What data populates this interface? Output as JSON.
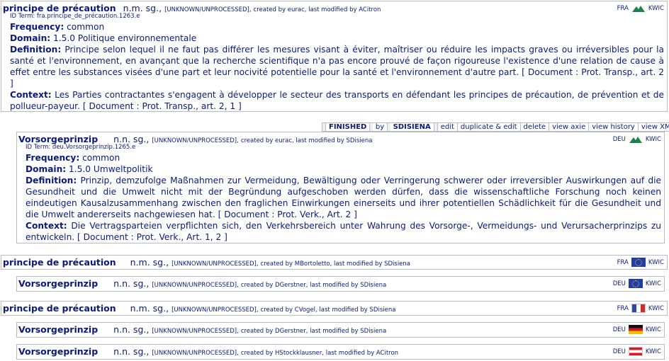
{
  "toolbar": {
    "status": "FINISHED",
    "by": "by",
    "user": "SDISIENA",
    "edit": "edit",
    "duplicate": "duplicate & edit",
    "delete": "delete",
    "view_axie": "view axie",
    "view_history": "view history",
    "view_xml": "view XML"
  },
  "entries": [
    {
      "term": "principe de précaution",
      "gram": "n.m. sg.,",
      "status": "[UNKNOWN/UNPROCESSED],",
      "meta": "created by eurac, last modified by ACitron",
      "lang": "FRA",
      "kwic": "KWIC",
      "flag": "alpine",
      "id_term": "ID Term: fra.principe_de_précaution.1263.e",
      "frequency_label": "Frequency:",
      "frequency": "common",
      "domain_label": "Domain:",
      "domain": "1.5.0 Politique environnementale",
      "definition_label": "Definition:",
      "definition": "Principe selon lequel il ne faut pas différer les mesures visant à éviter, maîtriser ou réduire les impacts graves ou irréversibles pour la santé et l'environnement, en avançant que la recherche scientifique n'a pas encore prouvé de façon rigoureuse l'existence d'une relation de cause à effet entre les substances visées d'une part et leur nocivité potentielle pour la santé et l'environnement d'autre part. [ Document : Prot. Transp., art. 2 ]",
      "context_label": "Context:",
      "context": "Les Parties contractantes s'engagent à développer le secteur des transports en défendant les principes de précaution, de prévention et de pollueur-payeur. [ Document : Prot. Transp., art. 2, 1 ]"
    },
    {
      "term": "Vorsorgeprinzip",
      "gram": "n.n. sg.,",
      "status": "[UNKNOWN/UNPROCESSED],",
      "meta": "created by eurac, last modified by SDisiena",
      "lang": "DEU",
      "kwic": "KWIC",
      "flag": "alpine",
      "id_term": "ID Term: deu.Vorsorgeprinzip.1265.e",
      "frequency_label": "Frequency:",
      "frequency": "common",
      "domain_label": "Domain:",
      "domain": "1.5.0 Umweltpolitik",
      "definition_label": "Definition:",
      "definition": "Prinzip, demzufolge Maßnahmen zur Vermeidung, Bewältigung oder Verringerung schwerer oder irreversibler Auswirkungen auf die Gesundheit und die Umwelt nicht mit der Begründung aufgeschoben werden dürfen, dass die wissenschaftliche Forschung noch keinen eindeutigen Kausalzusammenhang zwischen den fraglichen Einwirkungen einerseits und ihrer potentiellen Schädlichkeit für die Gesundheit und die Umwelt andererseits nachgewiesen hat. [ Document : Prot. Verk., Art. 2 ]",
      "context_label": "Context:",
      "context": "Die Vertragsparteien verpflichten sich, den Verkehrsbereich unter Wahrung des Vorsorge-, Vermeidungs- und Verursacherprinzips zu entwickeln. [ Document : Prot. Verk., Art. 1, 2 ]"
    },
    {
      "term": "principe de précaution",
      "gram": "n.m. sg.,",
      "status": "[UNKNOWN/UNPROCESSED],",
      "meta": "created by MBortoletto, last modified by SDisiena",
      "lang": "FRA",
      "kwic": "KWIC",
      "flag": "eu"
    },
    {
      "term": "Vorsorgeprinzip",
      "gram": "n.n. sg.,",
      "status": "[UNKNOWN/UNPROCESSED],",
      "meta": "created by DGerstner, last modified by SDisiena",
      "lang": "DEU",
      "kwic": "KWIC",
      "flag": "eu"
    },
    {
      "term": "principe de précaution",
      "gram": "n.m. sg.,",
      "status": "[UNKNOWN/UNPROCESSED],",
      "meta": "created by CVogel, last modified by SDisiena",
      "lang": "FRA",
      "kwic": "KWIC",
      "flag": "fr"
    },
    {
      "term": "Vorsorgeprinzip",
      "gram": "n.n. sg.,",
      "status": "[UNKNOWN/UNPROCESSED],",
      "meta": "created by DGerstner, last modified by SDisiena",
      "lang": "DEU",
      "kwic": "KWIC",
      "flag": "de"
    },
    {
      "term": "Vorsorgeprinzip",
      "gram": "n.n. sg.,",
      "status": "[UNKNOWN/UNPROCESSED],",
      "meta": "created by HStockklausner, last modified by ACitron",
      "lang": "DEU",
      "kwic": "KWIC",
      "flag": "at"
    }
  ],
  "colors": {
    "text": "#0a1a7a",
    "border": "#b9bcc6",
    "status_bg": "#eeeef0"
  }
}
